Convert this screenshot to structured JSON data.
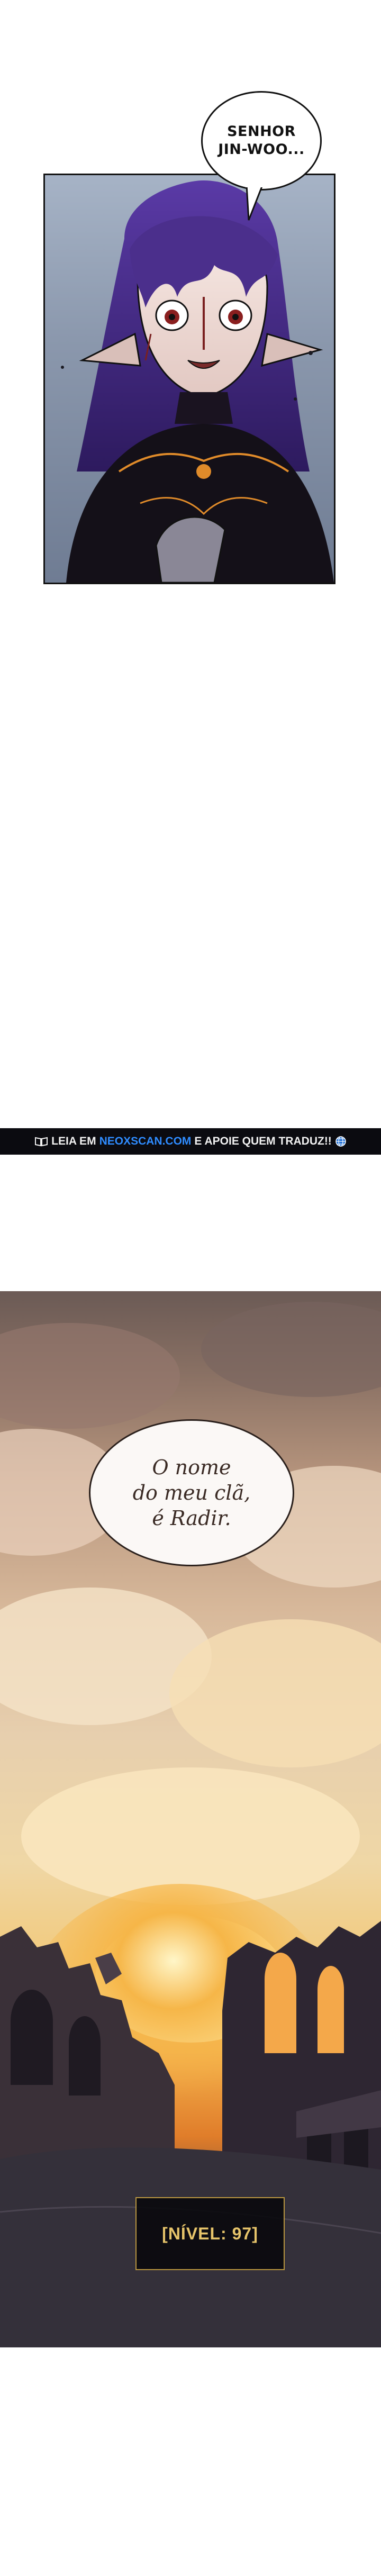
{
  "panel1": {
    "speech": "SENHOR\nJIN-WOO..."
  },
  "banner": {
    "prefix": "LEIA EM",
    "site": "NEOXSCAN.COM",
    "suffix": "E APOIE QUEM TRADUZ!!",
    "book_icon": "open-book-icon",
    "globe_icon": "globe-icon"
  },
  "panel2": {
    "speech": "O nome\ndo meu clã,\né Radir.",
    "level_label": "[NÍVEL: 97]"
  },
  "colors": {
    "banner_bg": "#0b0b10",
    "banner_link": "#2f8cff",
    "level_text": "#e6c46a",
    "hair": "#4b2f8c"
  }
}
